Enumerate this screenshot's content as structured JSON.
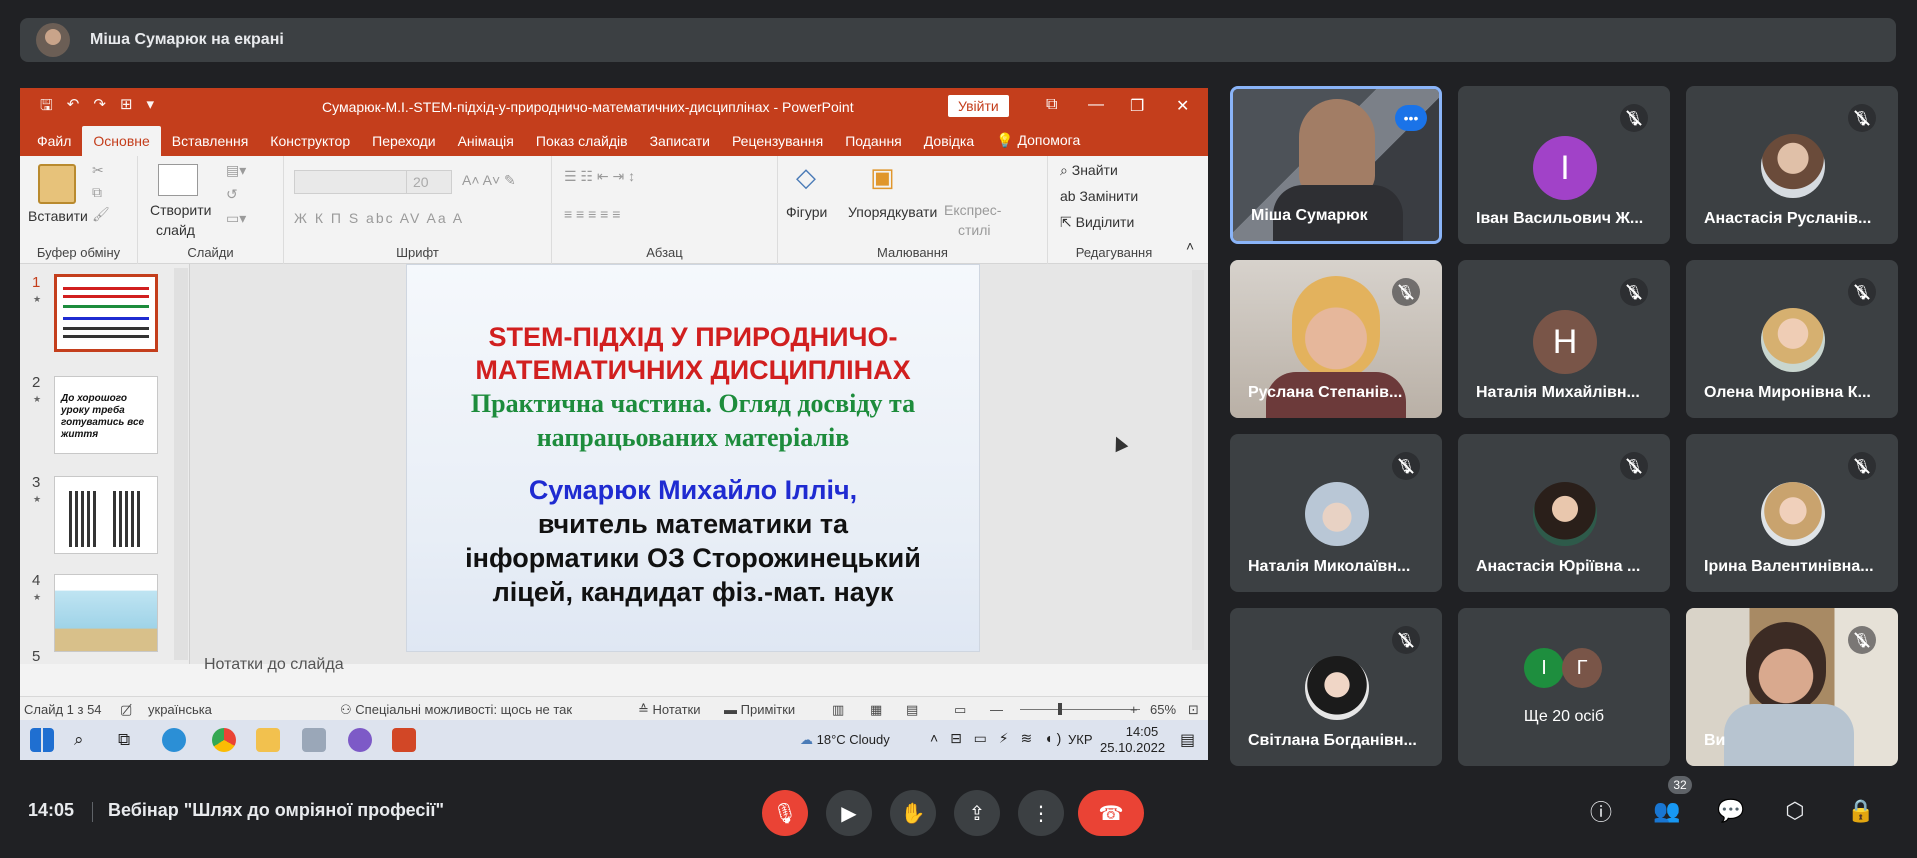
{
  "presenter": {
    "label": "Міша Сумарюк на екрані"
  },
  "powerpoint": {
    "doc_title": "Сумарюк-М.І.-STEM-підхід-у-природничо-математичних-дисциплінах  -  PowerPoint",
    "signin": "Увійти",
    "tabs": [
      "Файл",
      "Основне",
      "Вставлення",
      "Конструктор",
      "Переходи",
      "Анімація",
      "Показ слайдів",
      "Записати",
      "Рецензування",
      "Подання",
      "Довідка",
      "Допомога"
    ],
    "ribbon": {
      "paste": "Вставити",
      "clipboard": "Буфер обміну",
      "new_slide_1": "Створити",
      "new_slide_2": "слайд",
      "slides": "Слайди",
      "font_size": "20",
      "font_group": "Шрифт",
      "font_buttons": "Ж  К  П  S  abc  AV  Aa  A",
      "paragraph": "Абзац",
      "shapes": "Фігури",
      "arrange": "Упорядкувати",
      "express_1": "Експрес-",
      "express_2": "стилі",
      "drawing": "Малювання",
      "find": "Знайти",
      "replace": "Замінити",
      "select": "Виділити",
      "editing": "Редагування"
    },
    "thumb_numbers": [
      "1",
      "2",
      "3",
      "4",
      "5"
    ],
    "thumb2_text": "До хорошого уроку треба готуватись все життя",
    "slide": {
      "title_red_1": "STEM-ПІДХІД У ПРИРОДНИЧО-",
      "title_red_2": "МАТЕМАТИЧНИХ ДИСЦИПЛІНАХ",
      "green_1": "Практична частина. Огляд досвіду та",
      "green_2": "напрацьованих матеріалів",
      "blue": "Сумарюк Михайло Ілліч,",
      "black_1": "вчитель математики та",
      "black_2": "інформатики ОЗ Сторожинецький",
      "black_3": "ліцей, кандидат фіз.-мат. наук"
    },
    "notes": "Нотатки до слайда",
    "status": {
      "slide_of": "Слайд 1 з 54",
      "language": "українська",
      "accessibility": "Спеціальні можливості: щось не так",
      "notes_btn": "Нотатки",
      "comments_btn": "Примітки",
      "zoom": "65%"
    },
    "taskbar": {
      "weather": "18°C  Cloudy",
      "lang": "УКР",
      "time": "14:05",
      "date": "25.10.2022"
    }
  },
  "participants": [
    {
      "name": "Міша Сумарюк",
      "type": "video",
      "speaking": true
    },
    {
      "name": "Іван Васильович Ж...",
      "type": "letter",
      "letter": "І",
      "color": "#a142c8"
    },
    {
      "name": "Анастасія Русланів...",
      "type": "photo"
    },
    {
      "name": "Руслана Степанів...",
      "type": "video"
    },
    {
      "name": "Наталія Михайлівн...",
      "type": "letter",
      "letter": "Н",
      "color": "#795548"
    },
    {
      "name": "Олена Миронівна К...",
      "type": "photo"
    },
    {
      "name": "Наталія Миколаївн...",
      "type": "photo"
    },
    {
      "name": "Анастасія Юріївна ...",
      "type": "photo"
    },
    {
      "name": "Ірина Валентинівна...",
      "type": "photo"
    },
    {
      "name": "Світлана Богданівн...",
      "type": "photo"
    },
    {
      "name": "Ще 20 осіб",
      "type": "group",
      "letters": [
        "І",
        "Г"
      ]
    },
    {
      "name": "Ви",
      "type": "video"
    }
  ],
  "bottom": {
    "time": "14:05",
    "meeting_title": "Вебінар \"Шлях до омріяної професії\"",
    "people_count": "32"
  },
  "colors": {
    "accent": "#c43e1c",
    "end_call": "#ea4335",
    "tile_bg": "#3c4043"
  }
}
